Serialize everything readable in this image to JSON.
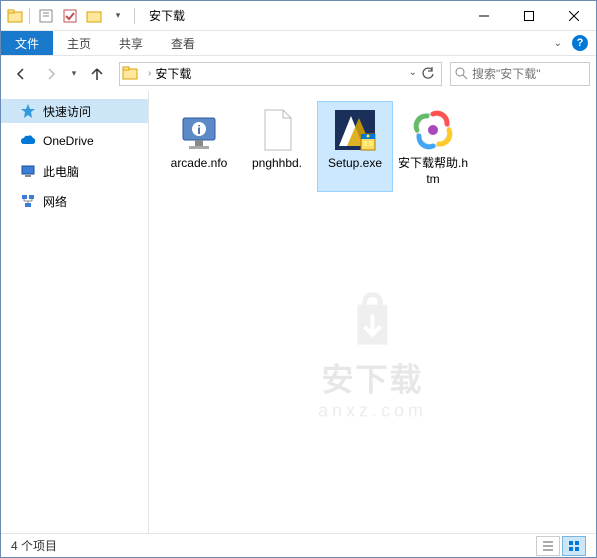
{
  "window": {
    "title": "安下载"
  },
  "ribbon": {
    "file": "文件",
    "tabs": [
      "主页",
      "共享",
      "查看"
    ]
  },
  "address": {
    "path": "安下载"
  },
  "search": {
    "placeholder": "搜索\"安下载\""
  },
  "sidebar": {
    "items": [
      {
        "label": "快速访问"
      },
      {
        "label": "OneDrive"
      },
      {
        "label": "此电脑"
      },
      {
        "label": "网络"
      }
    ]
  },
  "files": [
    {
      "label": "arcade.nfo"
    },
    {
      "label": "pnghhbd."
    },
    {
      "label": "Setup.exe"
    },
    {
      "label": "安下载帮助.htm"
    }
  ],
  "status": {
    "count": "4 个项目"
  },
  "watermark": {
    "text": "安下载",
    "sub": "anxz.com"
  }
}
